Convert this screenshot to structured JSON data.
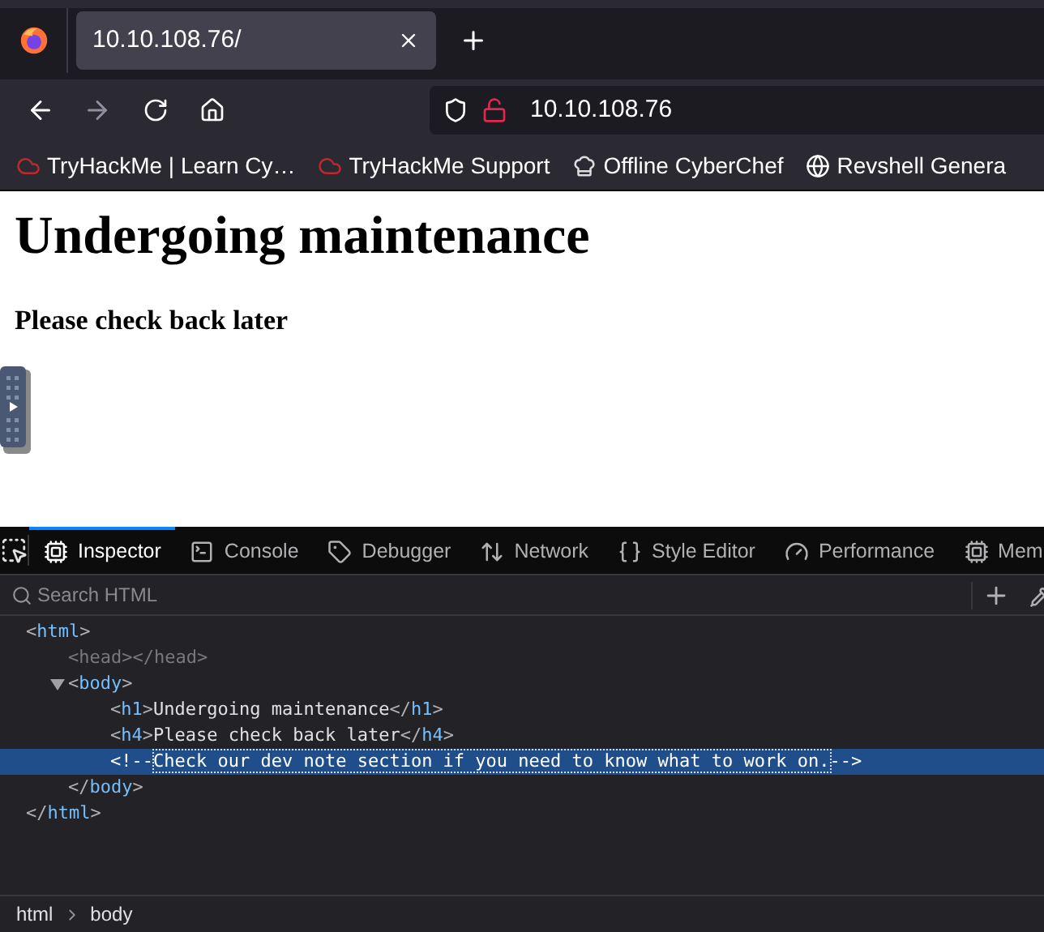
{
  "tab": {
    "title": "10.10.108.76/",
    "selected": true
  },
  "address": "10.10.108.76",
  "bookmarks": [
    {
      "kind": "cloud",
      "label": "TryHackMe | Learn Cy…"
    },
    {
      "kind": "cloud",
      "label": "TryHackMe Support"
    },
    {
      "kind": "chef",
      "label": "Offline CyberChef"
    },
    {
      "kind": "globe",
      "label": "Revshell Genera"
    }
  ],
  "page": {
    "heading": "Undergoing maintenance",
    "subheading": "Please check back later"
  },
  "devtools": {
    "tabs": [
      {
        "kind": "inspector",
        "label": "Inspector",
        "selected": true
      },
      {
        "kind": "console",
        "label": "Console",
        "selected": false
      },
      {
        "kind": "debugger",
        "label": "Debugger",
        "selected": false
      },
      {
        "kind": "network",
        "label": "Network",
        "selected": false
      },
      {
        "kind": "style",
        "label": "Style Editor",
        "selected": false
      },
      {
        "kind": "performance",
        "label": "Performance",
        "selected": false
      },
      {
        "kind": "memory",
        "label": "Mem",
        "selected": false
      }
    ],
    "search_placeholder": "Search HTML",
    "tree": [
      {
        "line": [
          {
            "kind": "punct",
            "text": "<"
          },
          {
            "kind": "tag",
            "text": "html"
          },
          {
            "kind": "punct",
            "text": ">"
          }
        ],
        "selected": false,
        "dimmed": false,
        "children": [
          {
            "line": [
              {
                "kind": "punct",
                "text": "<head></head>"
              }
            ],
            "selected": false,
            "dimmed": true
          },
          {
            "line": [
              {
                "kind": "punct",
                "text": "<"
              },
              {
                "kind": "tag",
                "text": "body"
              },
              {
                "kind": "punct",
                "text": ">"
              }
            ],
            "selected": false,
            "dimmed": false,
            "expanded": true,
            "children": [
              {
                "line": [
                  {
                    "kind": "punct",
                    "text": "<"
                  },
                  {
                    "kind": "tag",
                    "text": "h1"
                  },
                  {
                    "kind": "punct",
                    "text": ">"
                  },
                  {
                    "kind": "text",
                    "text": "Undergoing maintenance"
                  },
                  {
                    "kind": "punct",
                    "text": "</"
                  },
                  {
                    "kind": "tag",
                    "text": "h1"
                  },
                  {
                    "kind": "punct",
                    "text": ">"
                  }
                ],
                "selected": false,
                "dimmed": false
              },
              {
                "line": [
                  {
                    "kind": "punct",
                    "text": "<"
                  },
                  {
                    "kind": "tag",
                    "text": "h4"
                  },
                  {
                    "kind": "punct",
                    "text": ">"
                  },
                  {
                    "kind": "text",
                    "text": "Please check back later"
                  },
                  {
                    "kind": "punct",
                    "text": "</"
                  },
                  {
                    "kind": "tag",
                    "text": "h4"
                  },
                  {
                    "kind": "punct",
                    "text": ">"
                  }
                ],
                "selected": false,
                "dimmed": false
              },
              {
                "line": [
                  {
                    "kind": "punct",
                    "text": "<!--"
                  },
                  {
                    "kind": "comment",
                    "text": "Check our dev note section if you need to know what to work on."
                  },
                  {
                    "kind": "punct",
                    "text": "-->"
                  }
                ],
                "selected": true,
                "dimmed": false
              }
            ],
            "end": [
              {
                "kind": "punct",
                "text": "</"
              },
              {
                "kind": "tag",
                "text": "body"
              },
              {
                "kind": "punct",
                "text": ">"
              }
            ]
          }
        ],
        "end": [
          {
            "kind": "punct",
            "text": "</"
          },
          {
            "kind": "tag",
            "text": "html"
          },
          {
            "kind": "punct",
            "text": ">"
          }
        ]
      }
    ],
    "breadcrumbs": [
      "html",
      "body"
    ]
  }
}
